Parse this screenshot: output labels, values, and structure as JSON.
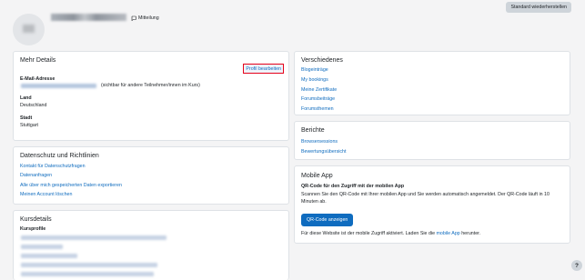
{
  "header": {
    "reset_label": "Standard wiederherstellen",
    "message_label": "Mitteilung"
  },
  "details": {
    "title": "Mehr Details",
    "edit_label": "Profil bearbeiten",
    "email_label": "E-Mail-Adresse",
    "email_note": "(sichtbar für andere Teilnehmer/innen im Kurs)",
    "land_label": "Land",
    "land_value": "Deutschland",
    "stadt_label": "Stadt",
    "stadt_value": "Stuttgart"
  },
  "privacy": {
    "title": "Datenschutz und Richtlinien",
    "links": [
      "Kontakt für Datenschutzfragen",
      "Datenanfragen",
      "Alle über mich gespeicherten Daten exportieren",
      "Meinen Account löschen"
    ]
  },
  "courses": {
    "title": "Kursdetails",
    "profiles_label": "Kursprofile"
  },
  "misc": {
    "title": "Verschiedenes",
    "links": [
      "Blogeinträge",
      "My bookings",
      "Meine Zertifikate",
      "Forumsbeiträge",
      "Forumsthemen"
    ]
  },
  "reports": {
    "title": "Berichte",
    "links": [
      "Browsersessions",
      "Bewertungsübersicht"
    ]
  },
  "mobile": {
    "title": "Mobile App",
    "qr_heading": "QR-Code für den Zugriff mit der mobilen App",
    "qr_text": "Scannen Sie den QR-Code mit Ihrer mobilen App und Sie werden automatisch angemeldet. Der QR-Code läuft in 10 Minuten ab.",
    "qr_button": "QR-Code anzeigen",
    "footer_text": "Für diese Website ist der mobile Zugriff aktiviert. Laden Sie die",
    "footer_link": "mobile App",
    "footer_end": "herunter."
  },
  "help_label": "?"
}
